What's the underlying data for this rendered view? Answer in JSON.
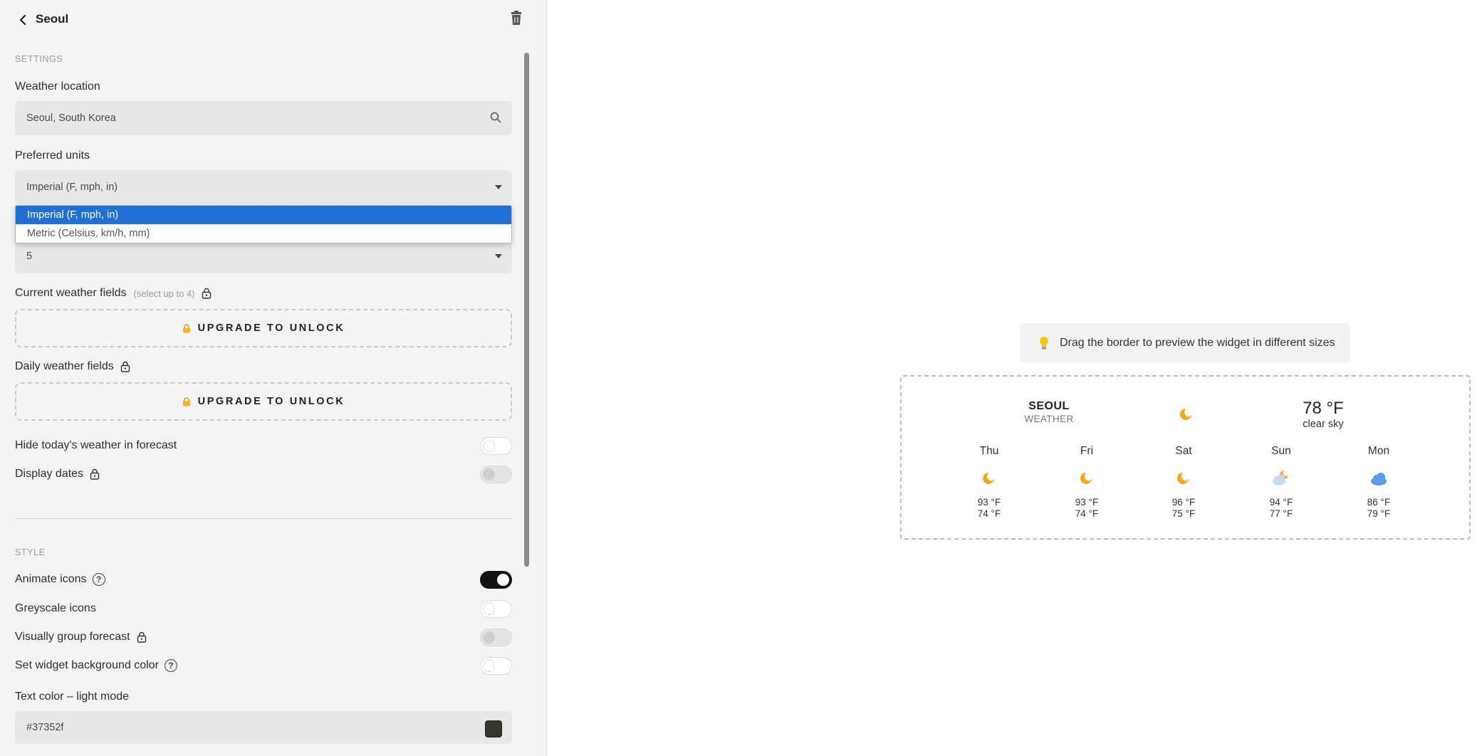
{
  "header": {
    "title": "Seoul"
  },
  "settings": {
    "section_label": "SETTINGS",
    "location_label": "Weather location",
    "location_value": "Seoul, South Korea",
    "units_label": "Preferred units",
    "units_value": "Imperial (F, mph, in)",
    "units_options": [
      "Imperial (F, mph, in)",
      "Metric (Celsius, km/h, mm)"
    ],
    "days_value": "5",
    "current_fields_label": "Current weather fields",
    "current_fields_hint": "(select up to 4)",
    "upgrade_label": "UPGRADE TO UNLOCK",
    "daily_fields_label": "Daily weather fields",
    "hide_today_label": "Hide today's weather in forecast",
    "display_dates_label": "Display dates"
  },
  "style": {
    "section_label": "STYLE",
    "animate_icons_label": "Animate icons",
    "greyscale_label": "Greyscale icons",
    "group_forecast_label": "Visually group forecast",
    "bg_color_label": "Set widget background color",
    "text_color_label": "Text color – light mode",
    "text_color_value": "#37352f",
    "animate_icons_on": true
  },
  "preview": {
    "tip": "Drag the border to preview the widget in different sizes",
    "city": "SEOUL",
    "subtitle": "WEATHER",
    "current_temp": "78 °F",
    "current_desc": "clear sky",
    "days": [
      {
        "name": "Thu",
        "icon": "night-moon-icon",
        "hi": "93 °F",
        "lo": "74 °F"
      },
      {
        "name": "Fri",
        "icon": "night-moon-icon",
        "hi": "93 °F",
        "lo": "74 °F"
      },
      {
        "name": "Sat",
        "icon": "night-moon-icon",
        "hi": "96 °F",
        "lo": "75 °F"
      },
      {
        "name": "Sun",
        "icon": "partly-cloudy-night-icon",
        "hi": "94 °F",
        "lo": "77 °F"
      },
      {
        "name": "Mon",
        "icon": "cloud-icon",
        "hi": "86 °F",
        "lo": "79 °F"
      }
    ]
  },
  "colors": {
    "accent_selected": "#1f6fd4",
    "sun_orange": "#f5a623",
    "cloud_blue": "#5b9bea"
  }
}
